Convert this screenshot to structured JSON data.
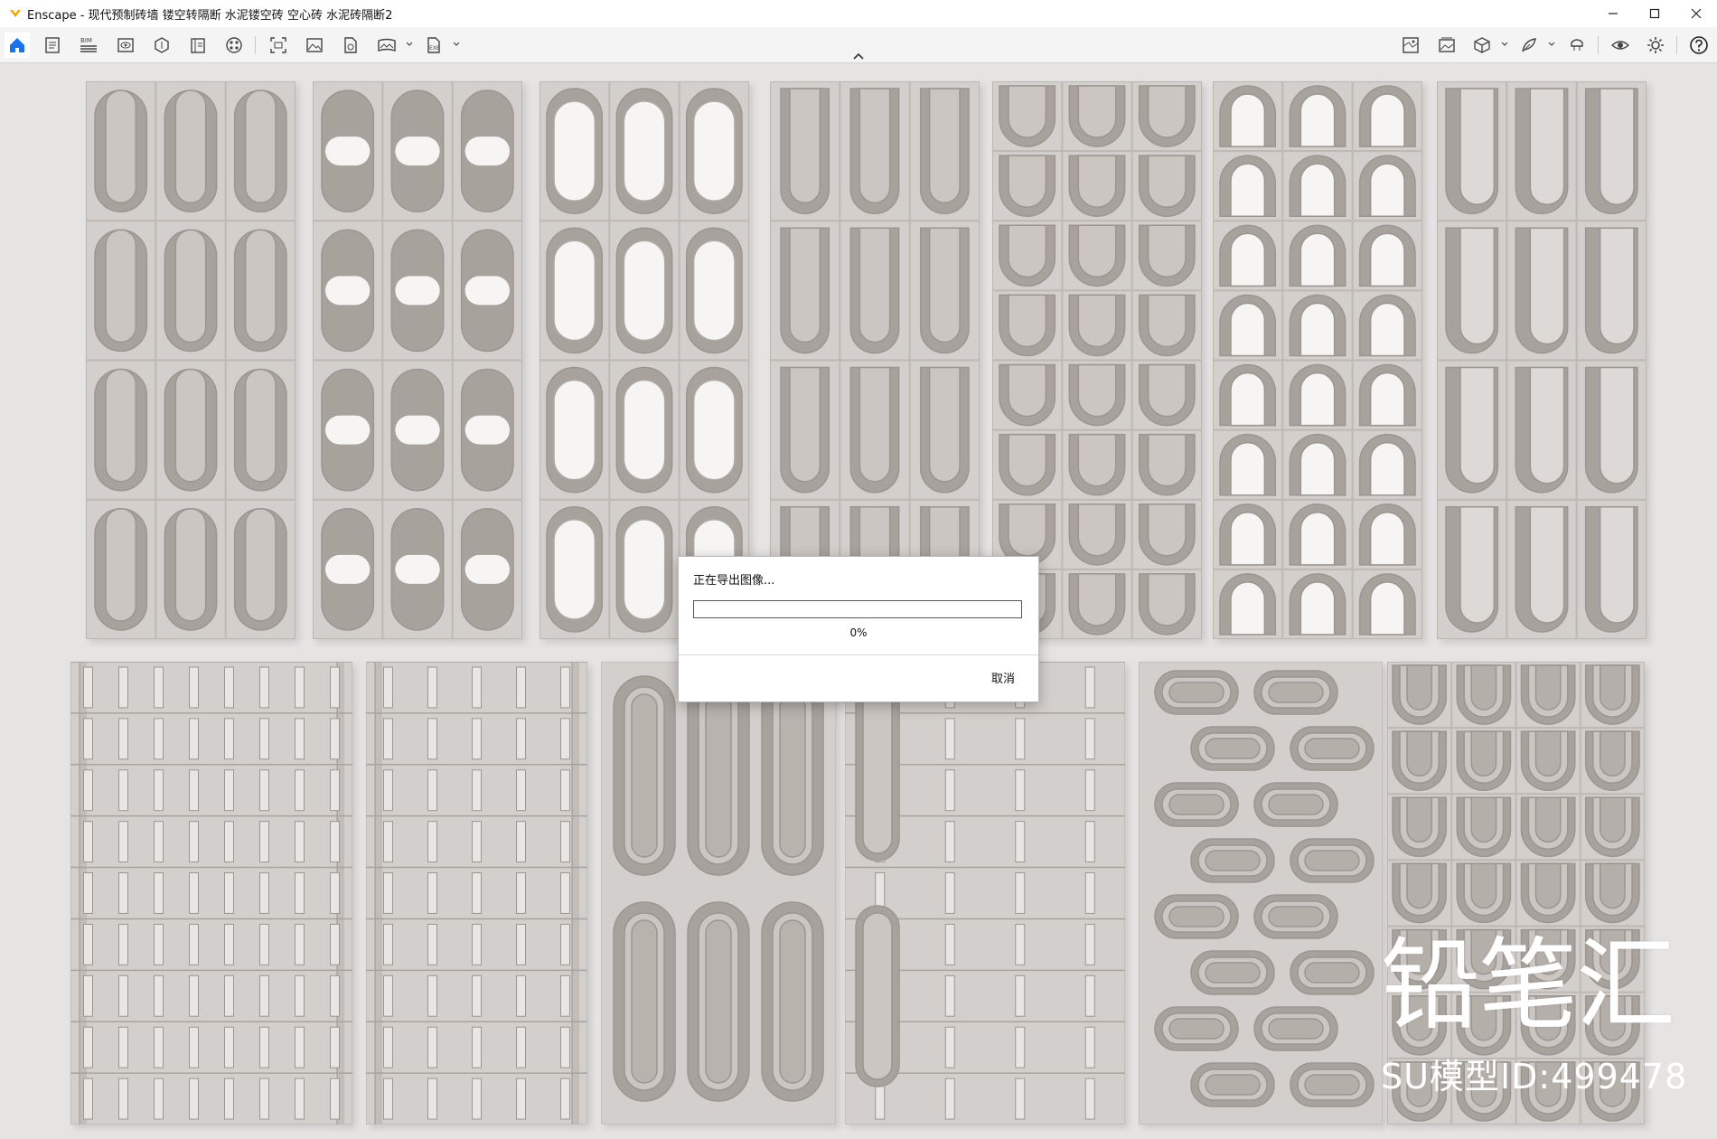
{
  "app": {
    "window_title": "Enscape - 现代预制砖墙 镂空转隔断 水泥镂空砖 空心砖 水泥砖隔断2"
  },
  "window_controls": [
    "minimize-icon",
    "maximize-icon",
    "close-icon"
  ],
  "toolbar": {
    "left": [
      "home-icon",
      "document-icon",
      "bim-icon",
      "view-icon",
      "asset-library-icon",
      "book-icon",
      "material-palette-icon",
      "screenshot-icon",
      "image-icon",
      "file-export-icon",
      "panorama-icon",
      "exe-export-icon"
    ],
    "bim_label": "BIM",
    "exe_label": "EXE",
    "right": [
      "map-icon",
      "image-gallery-icon",
      "cube-icon",
      "feather-icon",
      "vr-headset-icon",
      "eye-icon",
      "settings-icon",
      "help-icon"
    ]
  },
  "dialog": {
    "message": "正在导出图像...",
    "progress": 0,
    "progress_text": "0%",
    "cancel_label": "取消"
  },
  "watermark": {
    "logo_text": "铅笔汇",
    "model_id": "SU模型ID:499478"
  },
  "colors": {
    "brick": "#d3cfcc",
    "brick_recess": "#a8a29d",
    "brick_hole": "#f6f5f4",
    "progress_fill": "#1e90ff",
    "home_icon": "#1a73e8"
  }
}
